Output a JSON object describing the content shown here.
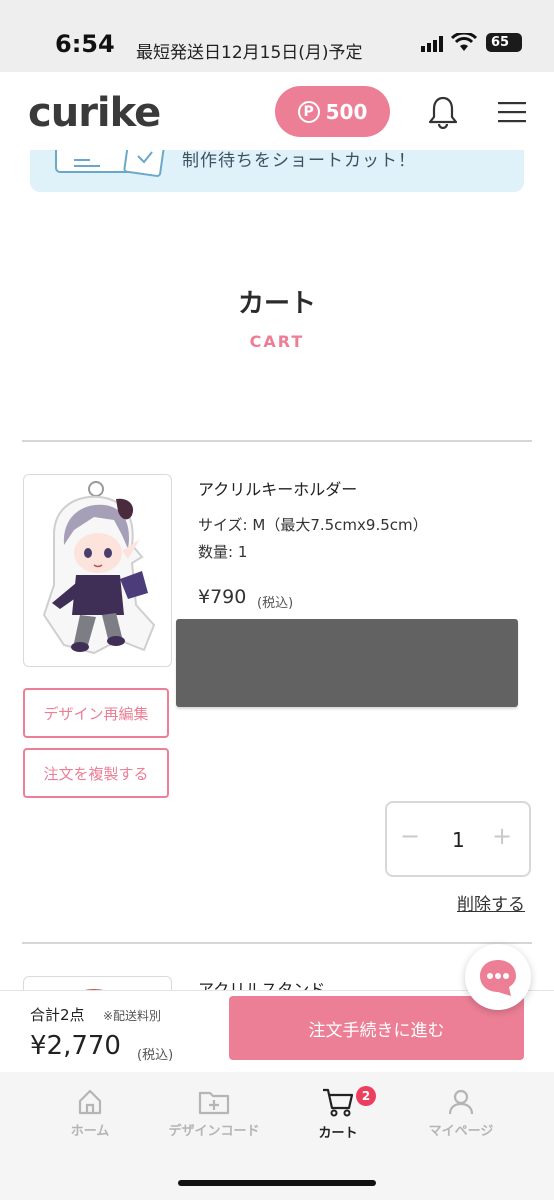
{
  "status_bar": {
    "time": "6:54",
    "shipping_notice": "最短発送日12月15日(月)予定",
    "battery": "65"
  },
  "header": {
    "logo": "curike",
    "points": "500",
    "points_symbol": "P"
  },
  "banner": {
    "text": "制作待ちをショートカット！"
  },
  "page": {
    "title": "カート",
    "subtitle": "CART"
  },
  "cart_items": [
    {
      "name": "アクリルキーホルダー",
      "size": "サイズ: M（最大7.5cmx9.5cm）",
      "quantity_label": "数量: 1",
      "price": "¥790",
      "tax": "(税込)",
      "edit_button": "デザイン再編集",
      "duplicate_button": "注文を複製する",
      "qty_minus": "−",
      "qty_value": "1",
      "qty_plus": "+",
      "delete": "削除する"
    },
    {
      "name": "アクリルスタンド"
    }
  ],
  "checkout": {
    "total_label": "合計2点",
    "shipping_note": "※配送料別",
    "total_price": "¥2,770",
    "tax": "(税込)",
    "button": "注文手続きに進む"
  },
  "bottom_nav": {
    "home": "ホーム",
    "design_code": "デザインコード",
    "cart": "カート",
    "cart_badge": "2",
    "mypage": "マイページ"
  },
  "colors": {
    "accent": "#ec7f95",
    "badge": "#ec3f5e",
    "banner_bg": "#dff1f9"
  }
}
